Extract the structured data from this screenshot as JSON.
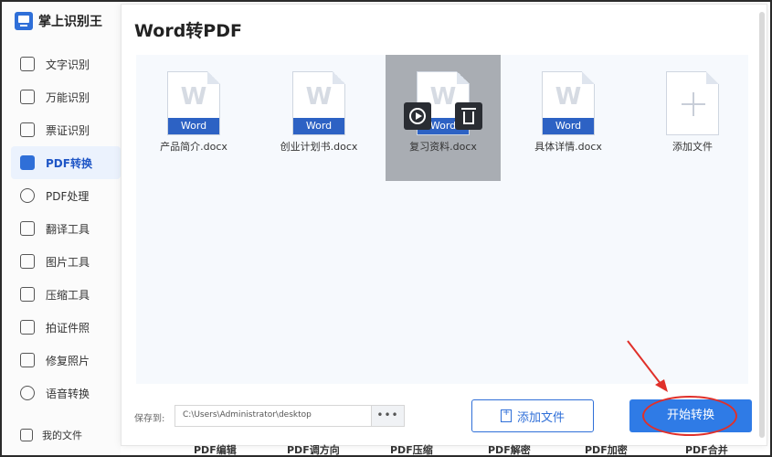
{
  "app": {
    "name": "掌上识别王"
  },
  "sidebar": {
    "items": [
      {
        "label": "文字识别",
        "icon": "text-recognition-icon"
      },
      {
        "label": "万能识别",
        "icon": "universal-scan-icon"
      },
      {
        "label": "票证识别",
        "icon": "ticket-icon"
      },
      {
        "label": "PDF转换",
        "icon": "pdf-convert-icon",
        "active": true
      },
      {
        "label": "PDF处理",
        "icon": "pdf-process-icon"
      },
      {
        "label": "翻译工具",
        "icon": "translate-icon"
      },
      {
        "label": "图片工具",
        "icon": "image-tool-icon"
      },
      {
        "label": "压缩工具",
        "icon": "compress-icon"
      },
      {
        "label": "拍证件照",
        "icon": "id-photo-icon"
      },
      {
        "label": "修复照片",
        "icon": "photo-repair-icon"
      },
      {
        "label": "语音转换",
        "icon": "voice-icon"
      }
    ],
    "my_files": "我的文件"
  },
  "dialog": {
    "title": "Word转PDF",
    "files": [
      {
        "name": "产品简介.docx",
        "badge": "Word",
        "glyph": "W"
      },
      {
        "name": "创业计划书.docx",
        "badge": "Word",
        "glyph": "W"
      },
      {
        "name": "复习资料.docx",
        "badge": "Word",
        "glyph": "W",
        "selected": true
      },
      {
        "name": "具体详情.docx",
        "badge": "Word",
        "glyph": "W"
      }
    ],
    "add_tile_label": "添加文件",
    "save_label": "保存到:",
    "save_path": "C:\\Users\\Administrator\\desktop",
    "path_more": "•••",
    "add_button": "添加文件",
    "start_button": "开始转换"
  },
  "behind_tabs": [
    "PDF编辑",
    "PDF调方向",
    "PDF压缩",
    "PDF解密",
    "PDF加密",
    "PDF合并"
  ],
  "colors": {
    "accent": "#2f7be6",
    "word_badge": "#2d62c4",
    "annotation": "#e0302a"
  }
}
